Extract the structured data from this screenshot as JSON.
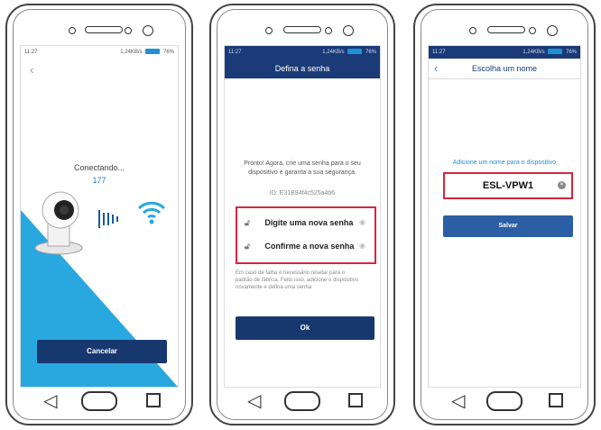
{
  "phone1": {
    "status_time": "11:27",
    "status_right": "1,24KB/s",
    "status_battery": "76%",
    "connecting_label": "Conectando...",
    "connecting_count": "177",
    "cancel_button": "Cancelar"
  },
  "phone2": {
    "status_time": "11:27",
    "status_right": "1,24KB/s",
    "status_battery": "76%",
    "title": "Defina a senha",
    "info": "Pronto! Agora, crie uma senha para o seu dispositivo e garanta a sua segurança.",
    "device_id": "ID: E31B94f4c525a4b6",
    "new_password_label": "Digite uma nova senha",
    "confirm_password_label": "Confirme a nova senha",
    "warning": "Em caso de falha é necessário resetar para o padrão de fábrica. Feito isso, adicione o dispositivo novamente e defina uma senha",
    "ok_button": "Ok"
  },
  "phone3": {
    "status_time": "11:27",
    "status_right": "1,24KB/s",
    "status_battery": "76%",
    "title": "Escolha um nome",
    "hint": "Adicione um nome para o dispositivo",
    "device_name": "ESL-VPW1",
    "save_button": "Salvar"
  },
  "colors": {
    "navy": "#17386e",
    "accent_blue": "#1f8fd6",
    "highlight_red": "#d7263d",
    "wedge_blue": "#29a8e0"
  }
}
